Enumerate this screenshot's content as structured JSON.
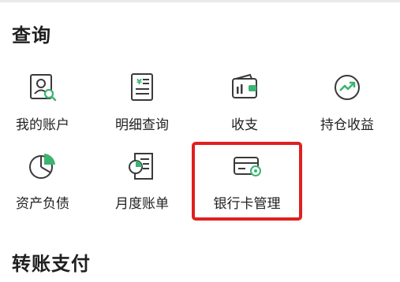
{
  "sections": [
    {
      "title": "查询"
    },
    {
      "title": "转账支付"
    }
  ],
  "grid": [
    {
      "label": "我的账户",
      "icon": "account-search-icon"
    },
    {
      "label": "明细查询",
      "icon": "statement-detail-icon"
    },
    {
      "label": "收支",
      "icon": "wallet-icon"
    },
    {
      "label": "持仓收益",
      "icon": "trend-up-icon"
    },
    {
      "label": "资产负债",
      "icon": "pie-chart-icon"
    },
    {
      "label": "月度账单",
      "icon": "monthly-bill-icon"
    },
    {
      "label": "银行卡管理",
      "icon": "bank-card-settings-icon"
    }
  ],
  "colors": {
    "icon_gray": "#3a3a3a",
    "icon_green": "#3cb371",
    "highlight": "#e02020"
  }
}
